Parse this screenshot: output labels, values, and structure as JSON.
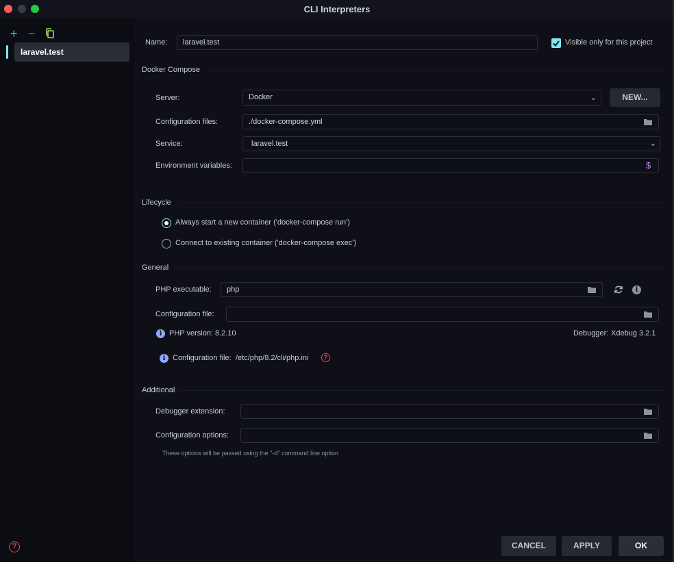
{
  "window": {
    "title": "CLI Interpreters"
  },
  "sidebar": {
    "items": [
      {
        "label": "laravel.test"
      }
    ],
    "tools": {
      "add": "+",
      "remove": "−"
    }
  },
  "form": {
    "name_label": "Name:",
    "name_value": "laravel.test",
    "visible_only_label": "Visible only for this project",
    "visible_only_checked": true
  },
  "docker_compose": {
    "section_title": "Docker Compose",
    "server_label": "Server:",
    "server_value": "Docker",
    "new_button": "NEW...",
    "config_files_label": "Configuration files:",
    "config_files_value": "./docker-compose.yml",
    "service_label": "Service:",
    "service_value": "laravel.test",
    "env_vars_label": "Environment variables:",
    "env_vars_value": ""
  },
  "lifecycle": {
    "section_title": "Lifecycle",
    "options": [
      {
        "label": "Always start a new container ('docker-compose run')",
        "checked": true
      },
      {
        "label": "Connect to existing container ('docker-compose exec')",
        "checked": false
      }
    ]
  },
  "general": {
    "section_title": "General",
    "php_exe_label": "PHP executable:",
    "php_exe_value": "php",
    "config_file_label": "Configuration file:",
    "config_file_value": "",
    "php_version_label": "PHP version:",
    "php_version_value": "8.2.10",
    "debugger_label": "Debugger:",
    "debugger_value": "Xdebug 3.2.1",
    "config_file_info_label": "Configuration file:",
    "config_file_info_value": "/etc/php/8.2/cli/php.ini"
  },
  "additional": {
    "section_title": "Additional",
    "debugger_ext_label": "Debugger extension:",
    "debugger_ext_value": "",
    "config_options_label": "Configuration options:",
    "config_options_value": "",
    "hint": "These options will be passed using the \"-d\" command line option"
  },
  "footer": {
    "cancel": "CANCEL",
    "apply": "APPLY",
    "ok": "OK"
  },
  "colors": {
    "accent": "#7ee7f3",
    "danger": "#e5484d",
    "info": "#8fa8ff"
  }
}
